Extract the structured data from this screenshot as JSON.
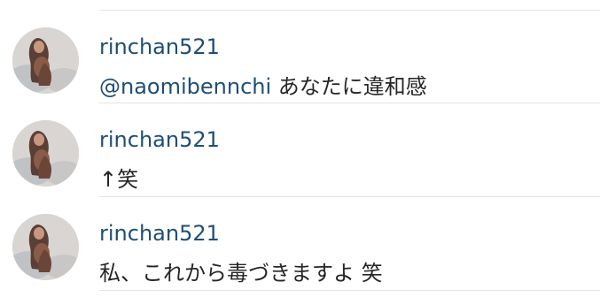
{
  "comments": [
    {
      "username": "rinchan521",
      "mention": "@naomibennchi",
      "text": " あなたに違和感"
    },
    {
      "username": "rinchan521",
      "mention": "",
      "text": "↑笑"
    },
    {
      "username": "rinchan521",
      "mention": "",
      "text": "私、これから毒づきますよ 笑"
    }
  ],
  "colors": {
    "username": "#1f4e76",
    "text": "#262626",
    "divider": "#e3e3e3"
  },
  "icons": {
    "avatar": "profile-photo-avatar"
  }
}
